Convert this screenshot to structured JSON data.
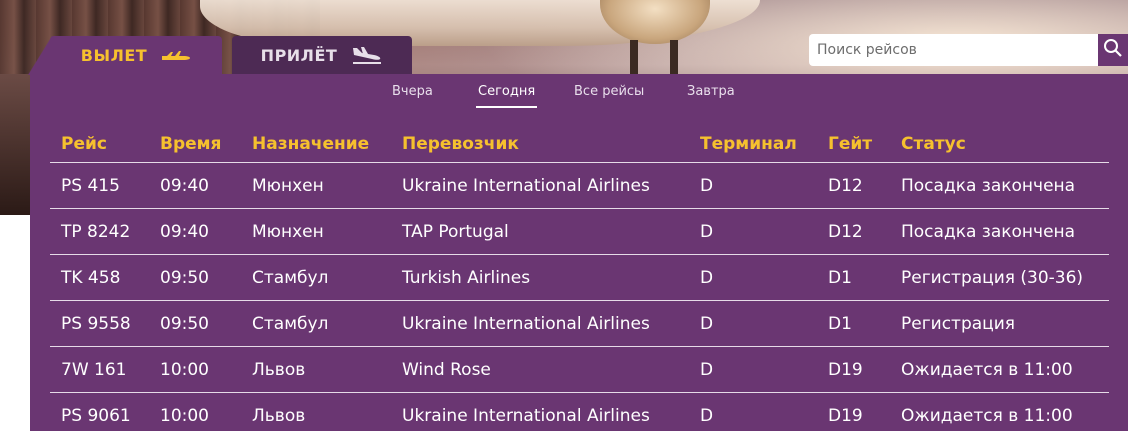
{
  "tabs": {
    "departure": {
      "label": "ВЫЛЕТ",
      "icon": "plane-takeoff-icon"
    },
    "arrival": {
      "label": "ПРИЛЁТ",
      "icon": "plane-landing-icon"
    }
  },
  "search": {
    "placeholder": "Поиск рейсов",
    "value": "",
    "icon": "search-icon"
  },
  "days": [
    {
      "label": "Вчера",
      "active": false
    },
    {
      "label": "Сегодня",
      "active": true
    },
    {
      "label": "Все рейсы",
      "active": false
    },
    {
      "label": "Завтра",
      "active": false
    }
  ],
  "columns": [
    "Рейс",
    "Время",
    "Назначение",
    "Перевозчик",
    "Терминал",
    "Гейт",
    "Статус"
  ],
  "flights": [
    {
      "flight": "PS 415",
      "time": "09:40",
      "destination": "Мюнхен",
      "carrier": "Ukraine International Airlines",
      "terminal": "D",
      "gate": "D12",
      "status": "Посадка закончена"
    },
    {
      "flight": "TP 8242",
      "time": "09:40",
      "destination": "Мюнхен",
      "carrier": "TAP Portugal",
      "terminal": "D",
      "gate": "D12",
      "status": "Посадка закончена"
    },
    {
      "flight": "TK 458",
      "time": "09:50",
      "destination": "Стамбул",
      "carrier": "Turkish Airlines",
      "terminal": "D",
      "gate": "D1",
      "status": "Регистрация (30-36)"
    },
    {
      "flight": "PS 9558",
      "time": "09:50",
      "destination": "Стамбул",
      "carrier": "Ukraine International Airlines",
      "terminal": "D",
      "gate": "D1",
      "status": "Регистрация"
    },
    {
      "flight": "7W 161",
      "time": "10:00",
      "destination": "Львов",
      "carrier": "Wind Rose",
      "terminal": "D",
      "gate": "D19",
      "status": "Ожидается в 11:00"
    },
    {
      "flight": "PS 9061",
      "time": "10:00",
      "destination": "Львов",
      "carrier": "Ukraine International Airlines",
      "terminal": "D",
      "gate": "D19",
      "status": "Ожидается в 11:00"
    }
  ],
  "colors": {
    "board": "#6a3672",
    "accent": "#f6c12e",
    "inactiveTab": "#4d2a54"
  }
}
